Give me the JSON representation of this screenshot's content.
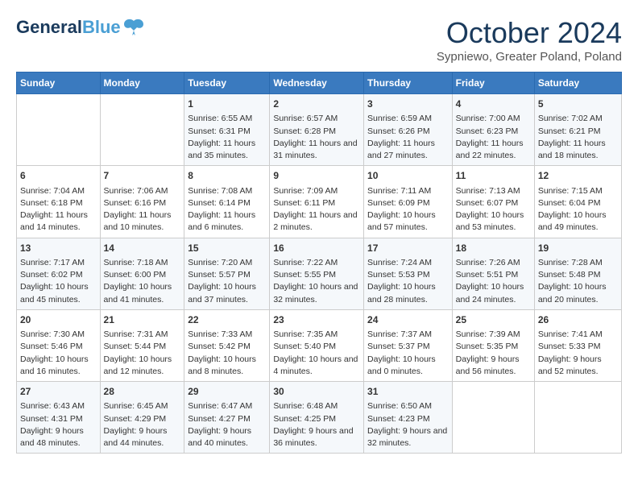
{
  "header": {
    "logo_line1": "General",
    "logo_line2": "Blue",
    "month": "October 2024",
    "location": "Sypniewo, Greater Poland, Poland"
  },
  "days_of_week": [
    "Sunday",
    "Monday",
    "Tuesday",
    "Wednesday",
    "Thursday",
    "Friday",
    "Saturday"
  ],
  "weeks": [
    [
      {
        "day": "",
        "sunrise": "",
        "sunset": "",
        "daylight": ""
      },
      {
        "day": "",
        "sunrise": "",
        "sunset": "",
        "daylight": ""
      },
      {
        "day": "1",
        "sunrise": "Sunrise: 6:55 AM",
        "sunset": "Sunset: 6:31 PM",
        "daylight": "Daylight: 11 hours and 35 minutes."
      },
      {
        "day": "2",
        "sunrise": "Sunrise: 6:57 AM",
        "sunset": "Sunset: 6:28 PM",
        "daylight": "Daylight: 11 hours and 31 minutes."
      },
      {
        "day": "3",
        "sunrise": "Sunrise: 6:59 AM",
        "sunset": "Sunset: 6:26 PM",
        "daylight": "Daylight: 11 hours and 27 minutes."
      },
      {
        "day": "4",
        "sunrise": "Sunrise: 7:00 AM",
        "sunset": "Sunset: 6:23 PM",
        "daylight": "Daylight: 11 hours and 22 minutes."
      },
      {
        "day": "5",
        "sunrise": "Sunrise: 7:02 AM",
        "sunset": "Sunset: 6:21 PM",
        "daylight": "Daylight: 11 hours and 18 minutes."
      }
    ],
    [
      {
        "day": "6",
        "sunrise": "Sunrise: 7:04 AM",
        "sunset": "Sunset: 6:18 PM",
        "daylight": "Daylight: 11 hours and 14 minutes."
      },
      {
        "day": "7",
        "sunrise": "Sunrise: 7:06 AM",
        "sunset": "Sunset: 6:16 PM",
        "daylight": "Daylight: 11 hours and 10 minutes."
      },
      {
        "day": "8",
        "sunrise": "Sunrise: 7:08 AM",
        "sunset": "Sunset: 6:14 PM",
        "daylight": "Daylight: 11 hours and 6 minutes."
      },
      {
        "day": "9",
        "sunrise": "Sunrise: 7:09 AM",
        "sunset": "Sunset: 6:11 PM",
        "daylight": "Daylight: 11 hours and 2 minutes."
      },
      {
        "day": "10",
        "sunrise": "Sunrise: 7:11 AM",
        "sunset": "Sunset: 6:09 PM",
        "daylight": "Daylight: 10 hours and 57 minutes."
      },
      {
        "day": "11",
        "sunrise": "Sunrise: 7:13 AM",
        "sunset": "Sunset: 6:07 PM",
        "daylight": "Daylight: 10 hours and 53 minutes."
      },
      {
        "day": "12",
        "sunrise": "Sunrise: 7:15 AM",
        "sunset": "Sunset: 6:04 PM",
        "daylight": "Daylight: 10 hours and 49 minutes."
      }
    ],
    [
      {
        "day": "13",
        "sunrise": "Sunrise: 7:17 AM",
        "sunset": "Sunset: 6:02 PM",
        "daylight": "Daylight: 10 hours and 45 minutes."
      },
      {
        "day": "14",
        "sunrise": "Sunrise: 7:18 AM",
        "sunset": "Sunset: 6:00 PM",
        "daylight": "Daylight: 10 hours and 41 minutes."
      },
      {
        "day": "15",
        "sunrise": "Sunrise: 7:20 AM",
        "sunset": "Sunset: 5:57 PM",
        "daylight": "Daylight: 10 hours and 37 minutes."
      },
      {
        "day": "16",
        "sunrise": "Sunrise: 7:22 AM",
        "sunset": "Sunset: 5:55 PM",
        "daylight": "Daylight: 10 hours and 32 minutes."
      },
      {
        "day": "17",
        "sunrise": "Sunrise: 7:24 AM",
        "sunset": "Sunset: 5:53 PM",
        "daylight": "Daylight: 10 hours and 28 minutes."
      },
      {
        "day": "18",
        "sunrise": "Sunrise: 7:26 AM",
        "sunset": "Sunset: 5:51 PM",
        "daylight": "Daylight: 10 hours and 24 minutes."
      },
      {
        "day": "19",
        "sunrise": "Sunrise: 7:28 AM",
        "sunset": "Sunset: 5:48 PM",
        "daylight": "Daylight: 10 hours and 20 minutes."
      }
    ],
    [
      {
        "day": "20",
        "sunrise": "Sunrise: 7:30 AM",
        "sunset": "Sunset: 5:46 PM",
        "daylight": "Daylight: 10 hours and 16 minutes."
      },
      {
        "day": "21",
        "sunrise": "Sunrise: 7:31 AM",
        "sunset": "Sunset: 5:44 PM",
        "daylight": "Daylight: 10 hours and 12 minutes."
      },
      {
        "day": "22",
        "sunrise": "Sunrise: 7:33 AM",
        "sunset": "Sunset: 5:42 PM",
        "daylight": "Daylight: 10 hours and 8 minutes."
      },
      {
        "day": "23",
        "sunrise": "Sunrise: 7:35 AM",
        "sunset": "Sunset: 5:40 PM",
        "daylight": "Daylight: 10 hours and 4 minutes."
      },
      {
        "day": "24",
        "sunrise": "Sunrise: 7:37 AM",
        "sunset": "Sunset: 5:37 PM",
        "daylight": "Daylight: 10 hours and 0 minutes."
      },
      {
        "day": "25",
        "sunrise": "Sunrise: 7:39 AM",
        "sunset": "Sunset: 5:35 PM",
        "daylight": "Daylight: 9 hours and 56 minutes."
      },
      {
        "day": "26",
        "sunrise": "Sunrise: 7:41 AM",
        "sunset": "Sunset: 5:33 PM",
        "daylight": "Daylight: 9 hours and 52 minutes."
      }
    ],
    [
      {
        "day": "27",
        "sunrise": "Sunrise: 6:43 AM",
        "sunset": "Sunset: 4:31 PM",
        "daylight": "Daylight: 9 hours and 48 minutes."
      },
      {
        "day": "28",
        "sunrise": "Sunrise: 6:45 AM",
        "sunset": "Sunset: 4:29 PM",
        "daylight": "Daylight: 9 hours and 44 minutes."
      },
      {
        "day": "29",
        "sunrise": "Sunrise: 6:47 AM",
        "sunset": "Sunset: 4:27 PM",
        "daylight": "Daylight: 9 hours and 40 minutes."
      },
      {
        "day": "30",
        "sunrise": "Sunrise: 6:48 AM",
        "sunset": "Sunset: 4:25 PM",
        "daylight": "Daylight: 9 hours and 36 minutes."
      },
      {
        "day": "31",
        "sunrise": "Sunrise: 6:50 AM",
        "sunset": "Sunset: 4:23 PM",
        "daylight": "Daylight: 9 hours and 32 minutes."
      },
      {
        "day": "",
        "sunrise": "",
        "sunset": "",
        "daylight": ""
      },
      {
        "day": "",
        "sunrise": "",
        "sunset": "",
        "daylight": ""
      }
    ]
  ]
}
